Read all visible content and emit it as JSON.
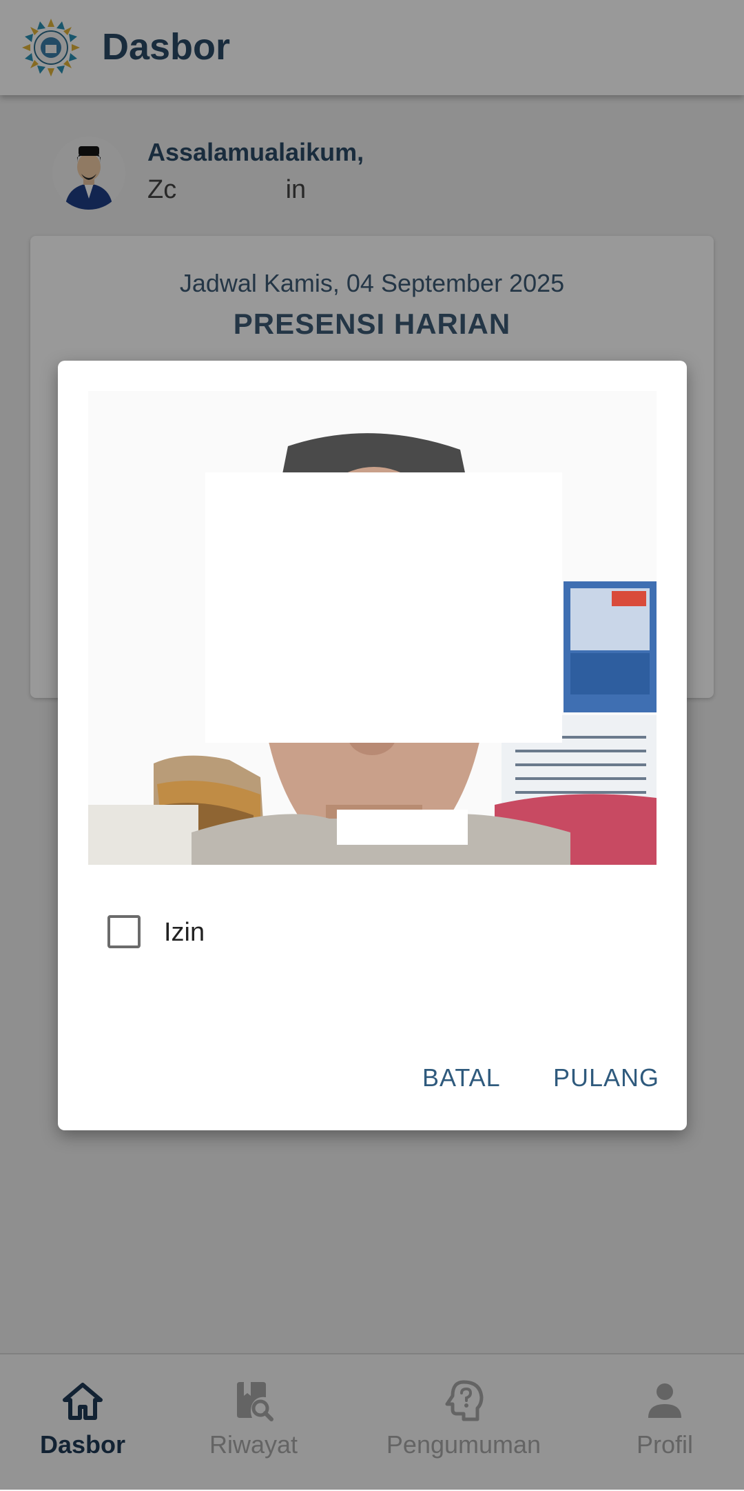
{
  "appbar": {
    "title": "Dasbor",
    "logo_icon": "organization-logo-icon"
  },
  "greeting": {
    "salutation": "Assalamualaikum,",
    "name": "Zc               in"
  },
  "schedule": {
    "date_text": "Jadwal Kamis, 04 September 2025",
    "heading": "PRESENSI HARIAN"
  },
  "dialog": {
    "photo": "selfie-camera-capture",
    "checkbox_label": "Izin",
    "checkbox_checked": false,
    "cancel_label": "BATAL",
    "confirm_label": "PULANG"
  },
  "bottom_nav": {
    "items": [
      {
        "label": "Dasbor",
        "icon": "home-icon",
        "active": true
      },
      {
        "label": "Riwayat",
        "icon": "history-search-icon",
        "active": false
      },
      {
        "label": "Pengumuman",
        "icon": "help-question-icon",
        "active": false
      },
      {
        "label": "Profil",
        "icon": "person-icon",
        "active": false
      }
    ]
  },
  "colors": {
    "primary": "#2b4a66",
    "accent_button": "#2f5a7d",
    "inactive": "#a7a7a7"
  }
}
